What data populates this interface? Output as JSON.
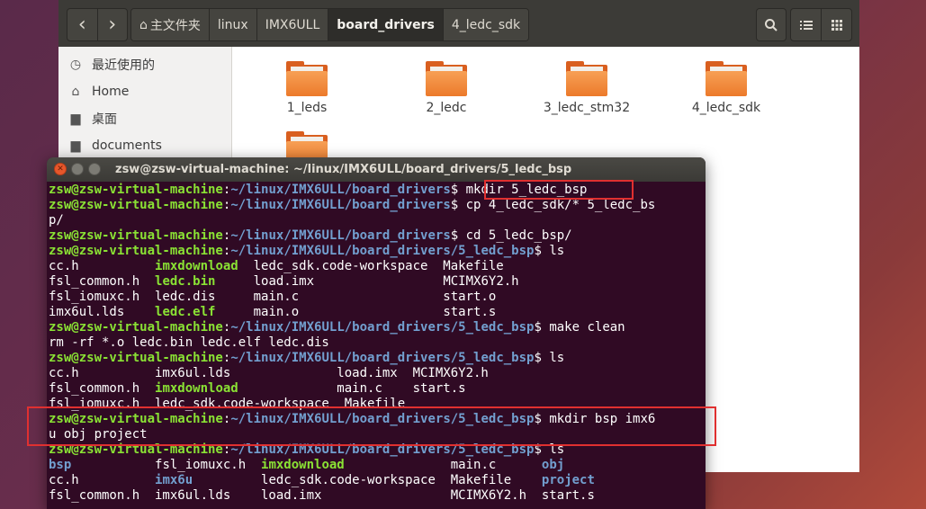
{
  "file_manager": {
    "nav": {
      "back_icon": "‹",
      "forward_icon": "›"
    },
    "breadcrumbs": [
      "主文件夹",
      "linux",
      "IMX6ULL",
      "board_drivers",
      "4_ledc_sdk"
    ],
    "sidebar": [
      {
        "icon": "clock-icon",
        "label": "最近使用的"
      },
      {
        "icon": "home-icon",
        "label": "Home"
      },
      {
        "icon": "folder-icon",
        "label": "桌面"
      },
      {
        "icon": "folder-icon",
        "label": "documents"
      }
    ],
    "folders": [
      "1_leds",
      "2_ledc",
      "3_ledc_stm32",
      "4_ledc_sdk",
      ""
    ],
    "colors": {
      "folder": "#ec7a2b",
      "header": "#3c3b37"
    }
  },
  "terminal": {
    "title": "zsw@zsw-virtual-machine: ~/linux/IMX6ULL/board_drivers/5_ledc_bsp",
    "colors": {
      "background": "#300a24",
      "user": "#8ae234",
      "path": "#729fcf",
      "highlight_box": "#e03030"
    },
    "lines": [
      [
        {
          "t": "zsw@zsw-virtual-machine",
          "c": "u"
        },
        {
          "t": ":",
          "c": ""
        },
        {
          "t": "~/linux/IMX6ULL/board_drivers",
          "c": "p"
        },
        {
          "t": "$ mkdir 5_ledc_bsp",
          "c": ""
        }
      ],
      [
        {
          "t": "zsw@zsw-virtual-machine",
          "c": "u"
        },
        {
          "t": ":",
          "c": ""
        },
        {
          "t": "~/linux/IMX6ULL/board_drivers",
          "c": "p"
        },
        {
          "t": "$ cp 4_ledc_sdk/* 5_ledc_bs",
          "c": ""
        }
      ],
      [
        {
          "t": "p/",
          "c": ""
        }
      ],
      [
        {
          "t": "zsw@zsw-virtual-machine",
          "c": "u"
        },
        {
          "t": ":",
          "c": ""
        },
        {
          "t": "~/linux/IMX6ULL/board_drivers",
          "c": "p"
        },
        {
          "t": "$ cd 5_ledc_bsp/",
          "c": ""
        }
      ],
      [
        {
          "t": "zsw@zsw-virtual-machine",
          "c": "u"
        },
        {
          "t": ":",
          "c": ""
        },
        {
          "t": "~/linux/IMX6ULL/board_drivers/5_ledc_bsp",
          "c": "p"
        },
        {
          "t": "$ ls",
          "c": ""
        }
      ],
      [
        {
          "t": "cc.h          ",
          "c": ""
        },
        {
          "t": "imxdownload",
          "c": "g"
        },
        {
          "t": "  ledc_sdk.code-workspace  Makefile",
          "c": ""
        }
      ],
      [
        {
          "t": "fsl_common.h  ",
          "c": ""
        },
        {
          "t": "ledc.bin",
          "c": "g"
        },
        {
          "t": "     load.imx                 MCIMX6Y2.h",
          "c": ""
        }
      ],
      [
        {
          "t": "fsl_iomuxc.h  ledc.dis     main.c                   start.o",
          "c": ""
        }
      ],
      [
        {
          "t": "imx6ul.lds    ",
          "c": ""
        },
        {
          "t": "ledc.elf",
          "c": "g"
        },
        {
          "t": "     main.o                   start.s",
          "c": ""
        }
      ],
      [
        {
          "t": "zsw@zsw-virtual-machine",
          "c": "u"
        },
        {
          "t": ":",
          "c": ""
        },
        {
          "t": "~/linux/IMX6ULL/board_drivers/5_ledc_bsp",
          "c": "p"
        },
        {
          "t": "$ make clean",
          "c": ""
        }
      ],
      [
        {
          "t": "rm -rf *.o ledc.bin ledc.elf ledc.dis",
          "c": ""
        }
      ],
      [
        {
          "t": "zsw@zsw-virtual-machine",
          "c": "u"
        },
        {
          "t": ":",
          "c": ""
        },
        {
          "t": "~/linux/IMX6ULL/board_drivers/5_ledc_bsp",
          "c": "p"
        },
        {
          "t": "$ ls",
          "c": ""
        }
      ],
      [
        {
          "t": "cc.h          imx6ul.lds              load.imx  MCIMX6Y2.h",
          "c": ""
        }
      ],
      [
        {
          "t": "fsl_common.h  ",
          "c": ""
        },
        {
          "t": "imxdownload",
          "c": "g"
        },
        {
          "t": "             main.c    start.s",
          "c": ""
        }
      ],
      [
        {
          "t": "fsl_iomuxc.h  ledc_sdk.code-workspace  Makefile",
          "c": ""
        }
      ],
      [
        {
          "t": "zsw@zsw-virtual-machine",
          "c": "u"
        },
        {
          "t": ":",
          "c": ""
        },
        {
          "t": "~/linux/IMX6ULL/board_drivers/5_ledc_bsp",
          "c": "p"
        },
        {
          "t": "$ mkdir bsp imx6",
          "c": ""
        }
      ],
      [
        {
          "t": "u obj project",
          "c": ""
        }
      ],
      [
        {
          "t": "zsw@zsw-virtual-machine",
          "c": "u"
        },
        {
          "t": ":",
          "c": ""
        },
        {
          "t": "~/linux/IMX6ULL/board_drivers/5_ledc_bsp",
          "c": "p"
        },
        {
          "t": "$ ls",
          "c": ""
        }
      ],
      [
        {
          "t": "bsp",
          "c": "b"
        },
        {
          "t": "           fsl_iomuxc.h  ",
          "c": ""
        },
        {
          "t": "imxdownload",
          "c": "g"
        },
        {
          "t": "              main.c      ",
          "c": ""
        },
        {
          "t": "obj",
          "c": "b"
        }
      ],
      [
        {
          "t": "cc.h          ",
          "c": ""
        },
        {
          "t": "imx6u",
          "c": "b"
        },
        {
          "t": "         ledc_sdk.code-workspace  Makefile    ",
          "c": ""
        },
        {
          "t": "project",
          "c": "b"
        }
      ],
      [
        {
          "t": "fsl_common.h  imx6ul.lds    load.imx                 MCIMX6Y2.h  start.s",
          "c": ""
        }
      ]
    ]
  }
}
